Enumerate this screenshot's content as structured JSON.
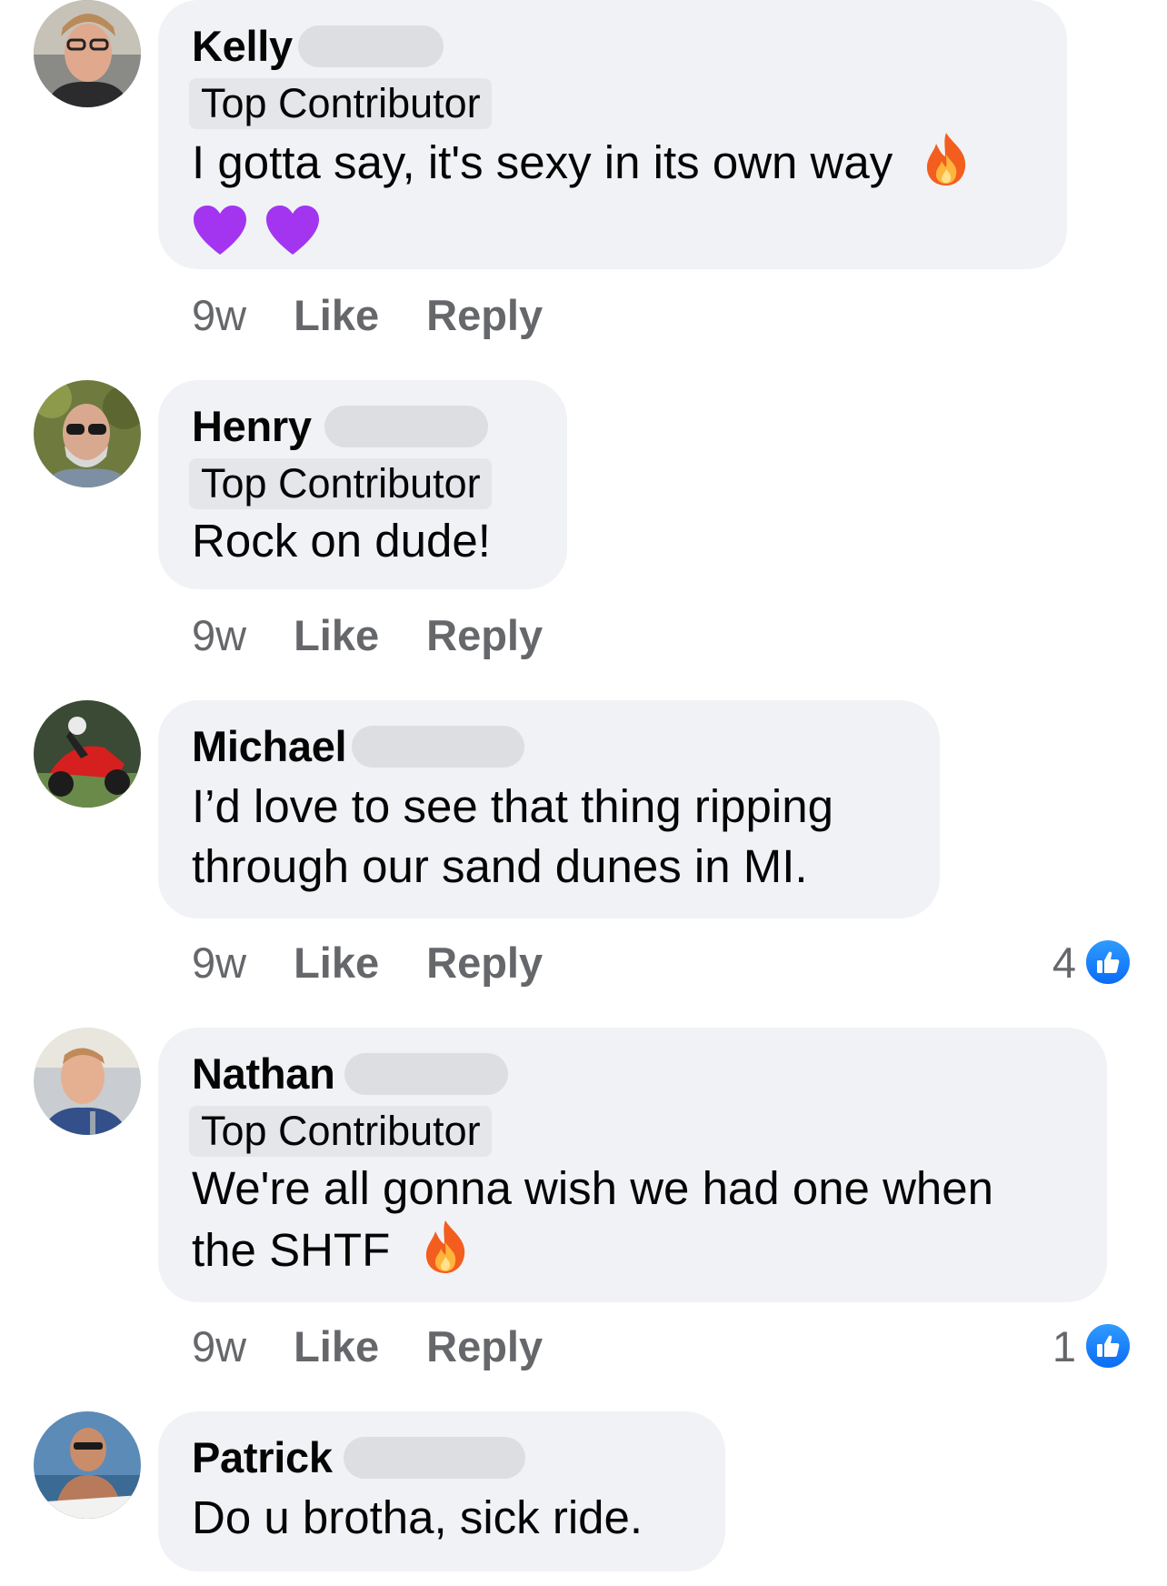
{
  "comments": [
    {
      "name": "Kelly",
      "badge": "Top Contributor",
      "text": "I gotta say, it's sexy in its own way",
      "time": "9w",
      "like_label": "Like",
      "reply_label": "Reply"
    },
    {
      "name": "Henry",
      "badge": "Top Contributor",
      "text": "Rock on dude!",
      "time": "9w",
      "like_label": "Like",
      "reply_label": "Reply"
    },
    {
      "name": "Michael",
      "text_line1": "I’d love to see that thing ripping",
      "text_line2": "through our sand dunes in MI.",
      "time": "9w",
      "like_label": "Like",
      "reply_label": "Reply",
      "reaction_count": "4"
    },
    {
      "name": "Nathan",
      "badge": "Top Contributor",
      "text_line1": "We're all gonna wish we had one when",
      "text_line2": "the SHTF",
      "time": "9w",
      "like_label": "Like",
      "reply_label": "Reply",
      "reaction_count": "1"
    },
    {
      "name": "Patrick",
      "text": "Do u brotha, sick ride."
    }
  ],
  "icons": {
    "reaction": "like-thumbs-up-icon",
    "emoji_fire": "fire-emoji-icon",
    "emoji_heart": "purple-heart-emoji-icon"
  },
  "colors": {
    "bubble": "#f0f2f5",
    "badge": "#e4e6ea",
    "meta_text": "#65676b",
    "like_blue": "#1877f2",
    "heart": "#a335f0"
  }
}
